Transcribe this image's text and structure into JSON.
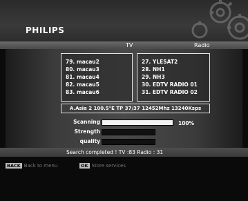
{
  "brand": "PHILIPS",
  "tabs": {
    "tv": "TV",
    "radio": "Radio"
  },
  "tv_channels": [
    "79. macau2",
    "80. macau3",
    "81. macau4",
    "82. macau5",
    "83. macau6"
  ],
  "radio_channels": [
    "27. YLESAT2",
    "28. NH1",
    "29. NH3",
    "30. EDTV RADIO 01",
    "31. EDTV RADIO 02"
  ],
  "transponder": "A.Asia 2 100.5°E TP 37/37  12452Mhz 13240Ksps",
  "meters": {
    "scanning": {
      "label": "Scanning",
      "value": 1.0,
      "text": "100%"
    },
    "strength": {
      "label": "Strength",
      "value": 0
    },
    "quality": {
      "label": "quality",
      "value": 0
    }
  },
  "status": "Search completed ! TV :83  Radio : 31",
  "hints": [
    {
      "key": "BACK",
      "text": "Back to menu"
    },
    {
      "key": "OK",
      "text": "Store services"
    }
  ],
  "colors": {
    "bar_fill": "#f2f2f2",
    "box_border": "#e6e6e6"
  }
}
